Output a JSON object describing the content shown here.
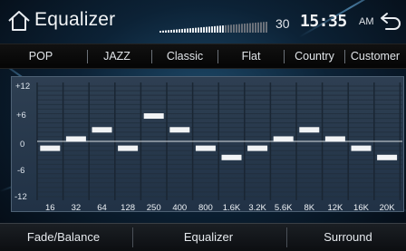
{
  "header": {
    "title": "Equalizer",
    "volume": "30",
    "volume_level": 0.6,
    "time": "15:35",
    "ampm": "AM"
  },
  "presets": [
    "POP",
    "JAZZ",
    "Classic",
    "Flat",
    "Country",
    "Customer"
  ],
  "eq": {
    "y_labels": [
      "+12",
      "+6",
      "0",
      "-6",
      "-12"
    ],
    "y_range": [
      -12,
      12
    ],
    "bands": [
      {
        "freq": "16",
        "gain": -1.5
      },
      {
        "freq": "32",
        "gain": 0.5
      },
      {
        "freq": "64",
        "gain": 2.5
      },
      {
        "freq": "128",
        "gain": -1.5
      },
      {
        "freq": "250",
        "gain": 5.5
      },
      {
        "freq": "400",
        "gain": 2.5
      },
      {
        "freq": "800",
        "gain": -1.5
      },
      {
        "freq": "1.6K",
        "gain": -3.5
      },
      {
        "freq": "3.2K",
        "gain": -1.5
      },
      {
        "freq": "5.6K",
        "gain": 0.5
      },
      {
        "freq": "8K",
        "gain": 2.5
      },
      {
        "freq": "12K",
        "gain": 0.5
      },
      {
        "freq": "16K",
        "gain": -1.5
      },
      {
        "freq": "20K",
        "gain": -3.5
      }
    ]
  },
  "bottom": [
    "Fade/Balance",
    "Equalizer",
    "Surround"
  ],
  "colors": {
    "bar": "#f2f4f6",
    "grid": "#22303f",
    "zero_line": "#d8dde2"
  }
}
